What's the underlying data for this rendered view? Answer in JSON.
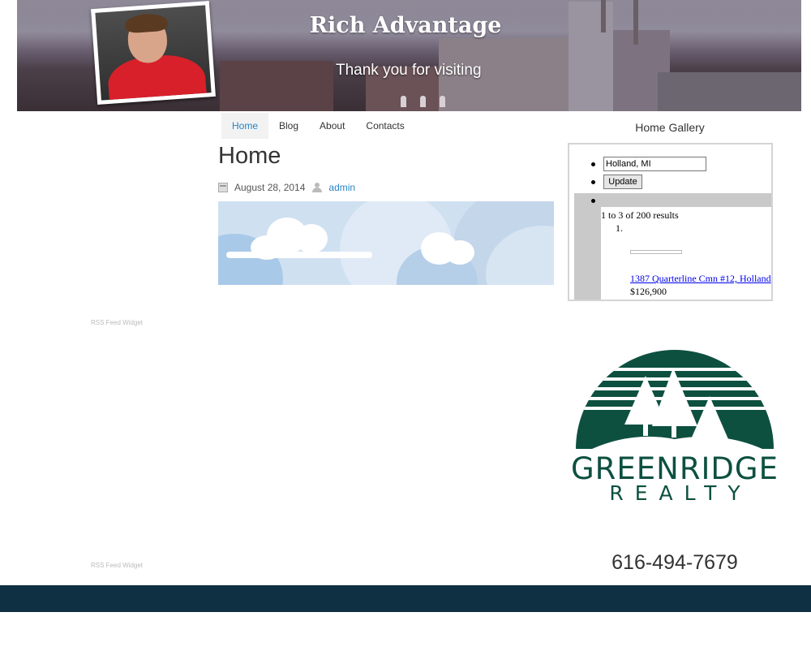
{
  "header": {
    "site_title": "Rich Advantage",
    "tagline": "Thank you for visiting"
  },
  "nav": {
    "items": [
      {
        "label": "Home",
        "active": true
      },
      {
        "label": "Blog",
        "active": false
      },
      {
        "label": "About",
        "active": false
      },
      {
        "label": "Contacts",
        "active": false
      }
    ]
  },
  "post": {
    "title": "Home",
    "date": "August 28, 2014",
    "author": "admin"
  },
  "sidebar": {
    "gallery_title": "Home Gallery",
    "location_value": "Holland, MI",
    "update_label": "Update",
    "results_text": "1 to 3 of 200 results",
    "item_number": "1.",
    "listing_address": "1387 Quarterline Cmn #12, Holland",
    "listing_price": "$126,900",
    "logo_name": "GREENRIDGE",
    "logo_sub": "REALTY",
    "phone": "616-494-7679"
  },
  "widgets": {
    "rss_label": "RSS Feed Widget"
  },
  "colors": {
    "accent": "#2a84c4",
    "footer": "#0e3042",
    "logo_green": "#0d5040"
  }
}
